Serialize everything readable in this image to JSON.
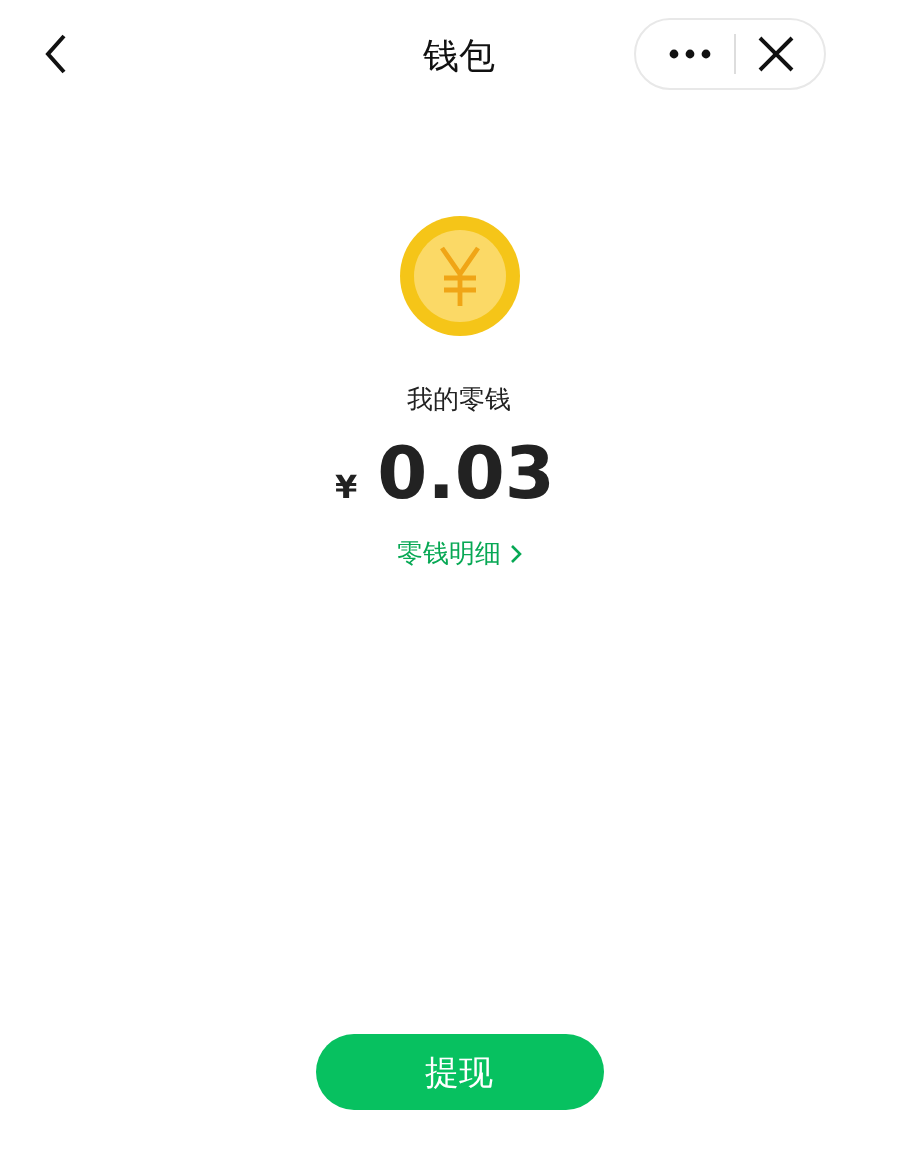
{
  "header": {
    "title": "钱包"
  },
  "balance": {
    "label": "我的零钱",
    "currency": "¥",
    "amount": "0.03",
    "details_link": "零钱明细"
  },
  "buttons": [
    {
      "label": "提现",
      "kind": "primary"
    }
  ]
}
